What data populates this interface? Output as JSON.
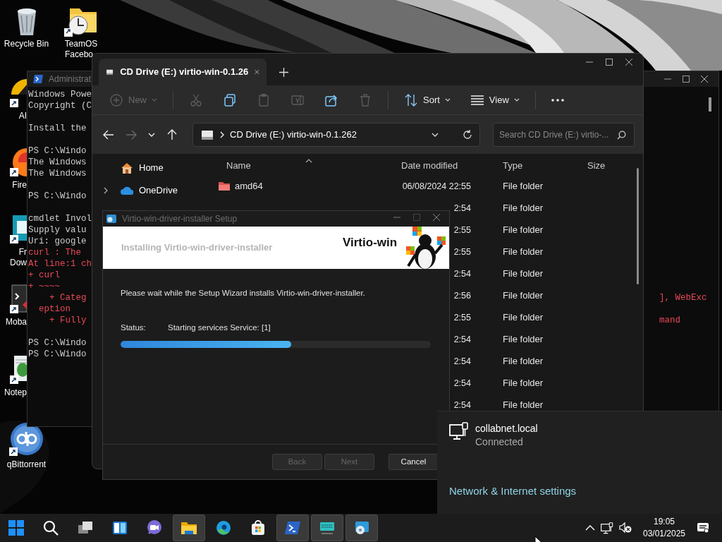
{
  "desktop_icons": [
    {
      "kind": "recycle",
      "label_lines": [
        "Recycle Bin"
      ]
    },
    {
      "kind": "folder-clock",
      "label_lines": [
        "TeamOS",
        "Facebo"
      ]
    },
    {
      "kind": "player",
      "label_lines": [
        "AI"
      ]
    },
    {
      "kind": "browser",
      "label_lines": [
        "Fire"
      ]
    },
    {
      "kind": "downloader",
      "label_lines": [
        "Fr",
        "Dow"
      ]
    },
    {
      "kind": "terminal",
      "label_lines": [
        "Moba"
      ]
    },
    {
      "kind": "notepad",
      "label_lines": [
        "Notep"
      ]
    },
    {
      "kind": "torrent",
      "label_lines": [
        "qBittorrent"
      ]
    }
  ],
  "powershell": {
    "title": "Administrat",
    "lines": [
      {
        "kind": "normal",
        "text": "Windows Powe"
      },
      {
        "kind": "normal",
        "text": "Copyright (C"
      },
      {
        "kind": "blank"
      },
      {
        "kind": "normal",
        "text": "Install the"
      },
      {
        "kind": "blank"
      },
      {
        "kind": "normal",
        "text": "PS C:\\Windo"
      },
      {
        "kind": "normal",
        "text": "The Windows"
      },
      {
        "kind": "normal",
        "text": "The Windows"
      },
      {
        "kind": "blank"
      },
      {
        "kind": "normal",
        "text": "PS C:\\Windo"
      },
      {
        "kind": "blank"
      },
      {
        "kind": "normal",
        "text": "cmdlet Invol"
      },
      {
        "kind": "normal",
        "text": "Supply valu"
      },
      {
        "kind": "normal",
        "text": "Uri: google"
      },
      {
        "kind": "error",
        "text": "curl : The"
      },
      {
        "kind": "error",
        "text": "At line:1 ch"
      },
      {
        "kind": "error",
        "text": "+ curl"
      },
      {
        "kind": "error",
        "text": "+ ~~~~"
      },
      {
        "kind": "error",
        "text": "    + Categ",
        "right": "], WebExc"
      },
      {
        "kind": "error",
        "text": "  eption"
      },
      {
        "kind": "error",
        "text": "    + Fully",
        "right": "mand"
      },
      {
        "kind": "blank"
      },
      {
        "kind": "normal",
        "text": "PS C:\\Windo"
      },
      {
        "kind": "normal",
        "text": "PS C:\\Windo"
      }
    ]
  },
  "explorer": {
    "tab": {
      "title": "CD Drive (E:) virtio-win-0.1.26",
      "selected": true
    },
    "toolbar": [
      {
        "kind": "new",
        "label": "New",
        "disabled": true,
        "group_end": true
      },
      {
        "kind": "cut",
        "disabled": true
      },
      {
        "kind": "copy",
        "disabled": false
      },
      {
        "kind": "paste",
        "disabled": true
      },
      {
        "kind": "rename",
        "disabled": true
      },
      {
        "kind": "share",
        "disabled": false
      },
      {
        "kind": "delete",
        "disabled": true,
        "group_end": true
      },
      {
        "kind": "sort",
        "label": "Sort",
        "disabled": false
      },
      {
        "kind": "view",
        "label": "View",
        "disabled": false,
        "group_end": true
      },
      {
        "kind": "more",
        "disabled": false
      }
    ],
    "address": "CD Drive (E:) virtio-win-0.1.262",
    "search": {
      "placeholder": "Search CD Drive (E:) virtio-..."
    },
    "sidebar": [
      {
        "kind": "home",
        "label": "Home",
        "expandable": false
      },
      {
        "kind": "cloud",
        "label": "OneDrive",
        "expandable": true
      }
    ],
    "columns": [
      {
        "label": "Name",
        "sorted": true
      },
      {
        "label": "Date modified",
        "sorted": false
      },
      {
        "label": "Type",
        "sorted": false
      },
      {
        "label": "Size",
        "sorted": false
      }
    ],
    "rows": [
      {
        "name": "amd64",
        "date": "06/08/2024 22:55",
        "type": "File folder"
      },
      {
        "date": "2:54",
        "type": "File folder"
      },
      {
        "date": "2:55",
        "type": "File folder"
      },
      {
        "date": "2:55",
        "type": "File folder"
      },
      {
        "date": "2:54",
        "type": "File folder"
      },
      {
        "date": "2:56",
        "type": "File folder"
      },
      {
        "date": "2:55",
        "type": "File folder"
      },
      {
        "date": "2:54",
        "type": "File folder"
      },
      {
        "date": "2:54",
        "type": "File folder"
      },
      {
        "date": "2:54",
        "type": "File folder"
      },
      {
        "date": "2:54",
        "type": "File folder"
      }
    ]
  },
  "setup": {
    "title": "Virtio-win-driver-installer Setup",
    "heading": "Installing Virtio-win-driver-installer",
    "brand": "Virtio-win",
    "message": "Please wait while the Setup Wizard installs Virtio-win-driver-installer.",
    "status_label": "Status:",
    "status": "Starting services Service: [1]",
    "level": 0.55,
    "buttons": [
      {
        "label": "Back",
        "disabled": true
      },
      {
        "label": "Next",
        "disabled": true
      },
      {
        "label": "Cancel",
        "disabled": false
      }
    ]
  },
  "network_flyout": {
    "network": "collabnet.local",
    "state": "Connected",
    "settings_link": "Network & Internet settings"
  },
  "taskbar": {
    "apps": [
      {
        "kind": "start",
        "selected": false
      },
      {
        "kind": "search",
        "selected": false
      },
      {
        "kind": "taskview",
        "selected": false
      },
      {
        "kind": "widgets",
        "selected": false
      },
      {
        "kind": "chat",
        "selected": false
      },
      {
        "kind": "explorer",
        "selected": true
      },
      {
        "kind": "edge",
        "selected": false
      },
      {
        "kind": "store",
        "selected": false
      },
      {
        "kind": "powershell",
        "selected": true
      },
      {
        "kind": "keyboard",
        "selected": true
      },
      {
        "kind": "setup",
        "selected": true
      }
    ],
    "time": "19:05",
    "date": "03/01/2025"
  }
}
